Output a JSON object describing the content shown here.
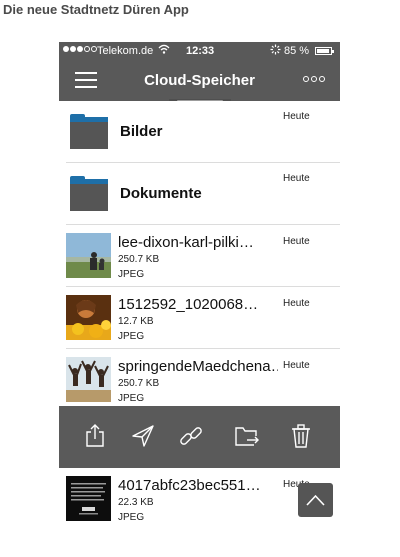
{
  "page": {
    "heading": "Die neue Stadtnetz Düren App"
  },
  "statusbar": {
    "carrier": "Telekom.de",
    "time": "12:33",
    "battery": "85 %"
  },
  "navbar": {
    "title": "Cloud-Speicher"
  },
  "folders": [
    {
      "name": "Bilder",
      "date": "Heute"
    },
    {
      "name": "Dokumente",
      "date": "Heute"
    }
  ],
  "files": [
    {
      "name": "lee-dixon-karl-pilki…",
      "size": "250.7 KB",
      "type": "JPEG",
      "date": "Heute"
    },
    {
      "name": "1512592_1020068…",
      "size": "12.7 KB",
      "type": "JPEG",
      "date": "Heute"
    },
    {
      "name": "springendeMaedchena…",
      "size": "250.7 KB",
      "type": "JPEG",
      "date": "Heute"
    },
    {
      "name": "4017abfc23bec551…",
      "size": "22.3 KB",
      "type": "JPEG",
      "date": "Heute"
    }
  ],
  "actions": [
    "share-icon",
    "send-icon",
    "link-icon",
    "move-to-folder-icon",
    "trash-icon"
  ],
  "colors": {
    "bar": "#595959",
    "folder_accent": "#1e6fa8"
  }
}
